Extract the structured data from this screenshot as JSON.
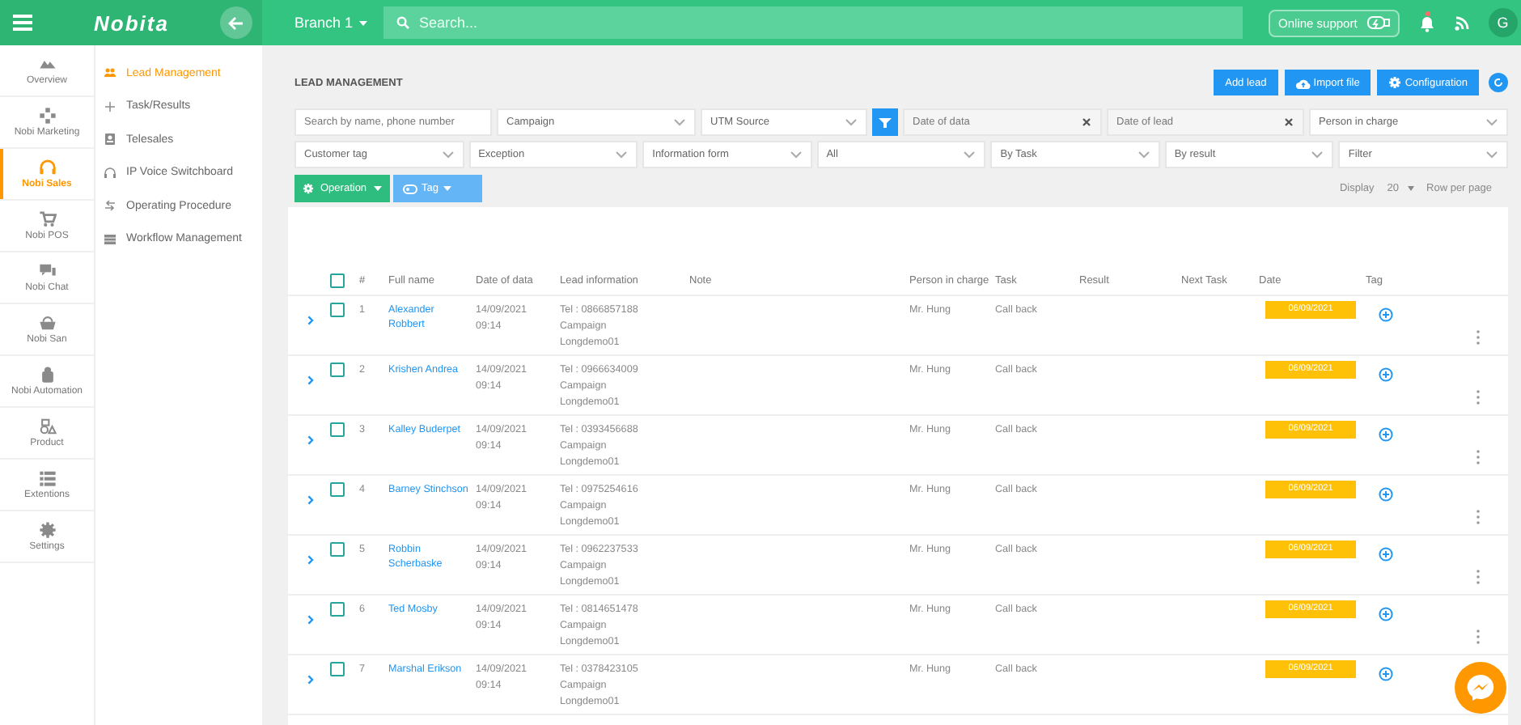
{
  "header": {
    "logo": "Nobita",
    "branch": "Branch 1",
    "search": {
      "placeholder": "Search..."
    },
    "support": "Online support",
    "avatar": "G",
    "notification": true
  },
  "rail": [
    {
      "label": "Overview",
      "selected": false
    },
    {
      "label": "Nobi Marketing",
      "selected": false
    },
    {
      "label": "Nobi Sales",
      "selected": true
    },
    {
      "label": "Nobi POS",
      "selected": false
    },
    {
      "label": "Nobi Chat",
      "selected": false
    },
    {
      "label": "Nobi San",
      "selected": false
    },
    {
      "label": "Nobi Automation",
      "selected": false
    },
    {
      "label": "Product",
      "selected": false
    },
    {
      "label": "Extentions",
      "selected": false
    },
    {
      "label": "Settings",
      "selected": false
    }
  ],
  "submenu": [
    {
      "label": "Lead Management",
      "selected": true
    },
    {
      "label": "Task/Results",
      "selected": false
    },
    {
      "label": "Telesales",
      "selected": false
    },
    {
      "label": "IP Voice Switchboard",
      "selected": false
    },
    {
      "label": "Operating Procedure",
      "selected": false
    },
    {
      "label": "Workflow Management",
      "selected": false
    }
  ],
  "page": {
    "title": "LEAD MANAGEMENT",
    "actions": [
      {
        "kind": "plain",
        "label": "Add lead"
      },
      {
        "kind": "upload",
        "label": "Import file"
      },
      {
        "kind": "gear",
        "label": "Configuration"
      }
    ]
  },
  "filters": [
    [
      {
        "kind": "text",
        "placeholder": "Search by name, phone number"
      },
      {
        "kind": "select",
        "label": "Campaign"
      },
      {
        "kind": "select",
        "label": "UTM Source"
      },
      {
        "kind": "button"
      },
      {
        "kind": "date",
        "placeholder": "Date of data"
      },
      {
        "kind": "date",
        "placeholder": "Date of lead"
      },
      {
        "kind": "select",
        "label": "Person in charge"
      }
    ],
    [
      {
        "kind": "select",
        "label": "Customer tag"
      },
      {
        "kind": "select",
        "label": "Exception"
      },
      {
        "kind": "select",
        "label": "Information form"
      },
      {
        "kind": "select",
        "label": "All"
      },
      {
        "kind": "select",
        "label": "By Task"
      },
      {
        "kind": "select",
        "label": "By result"
      },
      {
        "kind": "select",
        "label": "Filter"
      }
    ]
  ],
  "toolbar": {
    "operation": "Operation",
    "tag": "Tag",
    "display": "Display",
    "page_size": "20",
    "per_page": "Row per page"
  },
  "table": {
    "all_checked": false,
    "columns": [
      "#",
      "Full name",
      "Date of data",
      "Lead information",
      "Note",
      "Person in charge",
      "Task",
      "Result",
      "Next Task",
      "Date",
      "Tag"
    ],
    "rows": [
      {
        "checked": false,
        "no": "1",
        "name": "Alexander Robbert",
        "date": "14/09/2021",
        "time": "09:14",
        "lead": [
          "Tel : 0866857188",
          "Campaign",
          "Longdemo01"
        ],
        "person": "Mr. Hung",
        "task": "Call back",
        "due": "06/09/2021"
      },
      {
        "checked": false,
        "no": "2",
        "name": "Krishen Andrea",
        "date": "14/09/2021",
        "time": "09:14",
        "lead": [
          "Tel : 0966634009",
          "Campaign",
          "Longdemo01"
        ],
        "person": "Mr. Hung",
        "task": "Call back",
        "due": "06/09/2021"
      },
      {
        "checked": false,
        "no": "3",
        "name": "Kalley Buderpet",
        "date": "14/09/2021",
        "time": "09:14",
        "lead": [
          "Tel : 0393456688",
          "Campaign",
          "Longdemo01"
        ],
        "person": "Mr. Hung",
        "task": "Call back",
        "due": "06/09/2021"
      },
      {
        "checked": false,
        "no": "4",
        "name": "Barney Stinchson",
        "date": "14/09/2021",
        "time": "09:14",
        "lead": [
          "Tel : 0975254616",
          "Campaign",
          "Longdemo01"
        ],
        "person": "Mr. Hung",
        "task": "Call back",
        "due": "06/09/2021"
      },
      {
        "checked": false,
        "no": "5",
        "name": "Robbin Scherbaske",
        "date": "14/09/2021",
        "time": "09:14",
        "lead": [
          "Tel : 0962237533",
          "Campaign",
          "Longdemo01"
        ],
        "person": "Mr. Hung",
        "task": "Call back",
        "due": "06/09/2021"
      },
      {
        "checked": false,
        "no": "6",
        "name": "Ted Mosby",
        "date": "14/09/2021",
        "time": "09:14",
        "lead": [
          "Tel : 0814651478",
          "Campaign",
          "Longdemo01"
        ],
        "person": "Mr. Hung",
        "task": "Call back",
        "due": "06/09/2021"
      },
      {
        "checked": false,
        "no": "7",
        "name": "Marshal Erikson",
        "date": "14/09/2021",
        "time": "09:14",
        "lead": [
          "Tel : 0378423105",
          "Campaign",
          "Longdemo01"
        ],
        "person": "Mr. Hung",
        "task": "Call back",
        "due": "06/09/2021"
      }
    ]
  }
}
